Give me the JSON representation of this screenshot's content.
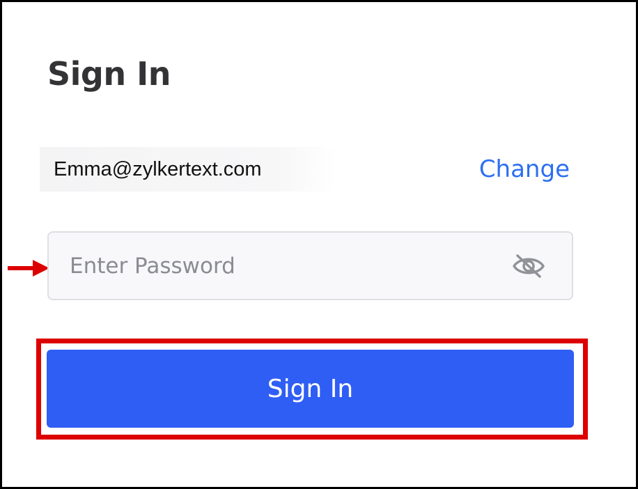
{
  "header": {
    "title": "Sign In"
  },
  "account": {
    "email": "Emma@zylkertext.com",
    "change_label": "Change"
  },
  "password": {
    "placeholder": "Enter Password",
    "value": "",
    "toggle_icon": "eye-slash-icon"
  },
  "actions": {
    "signin_label": "Sign In"
  },
  "annotations": {
    "arrow_icon": "red-arrow-icon",
    "highlight_icon": "red-highlight-box"
  },
  "colors": {
    "accent": "#2f5ef5",
    "link": "#2d6ff0",
    "annotation": "#dd0000"
  }
}
